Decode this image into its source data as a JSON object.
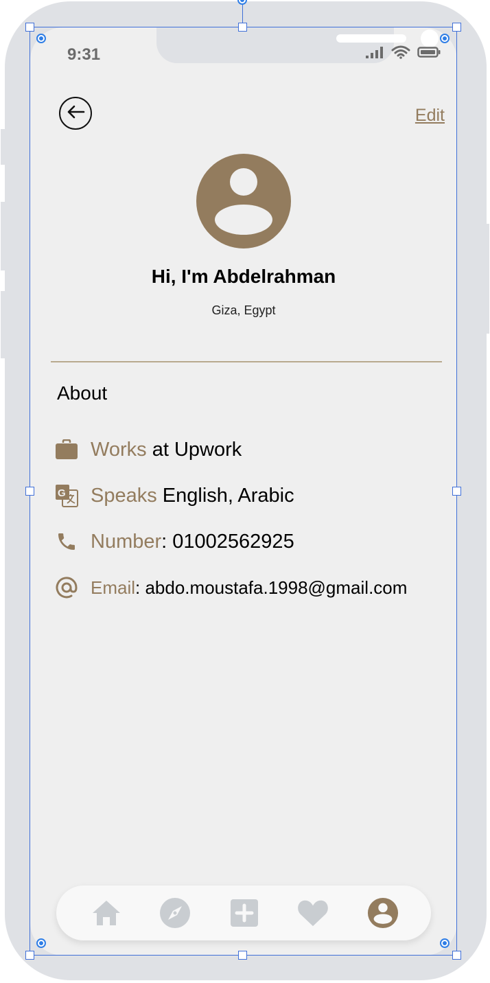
{
  "status_bar": {
    "time": "9:31",
    "icons": [
      "signal-icon",
      "wifi-icon",
      "battery-icon"
    ]
  },
  "header": {
    "back_icon": "arrow-left-icon",
    "edit_label": "Edit"
  },
  "profile": {
    "avatar_icon": "user-avatar-icon",
    "greeting": "Hi, I'm Abdelrahman",
    "location": "Giza, Egypt"
  },
  "about": {
    "title": "About",
    "items": [
      {
        "icon": "briefcase-icon",
        "label": "Works",
        "sep": " ",
        "value": "at Upwork"
      },
      {
        "icon": "translate-icon",
        "label": "Speaks",
        "sep": " ",
        "value": "English, Arabic"
      },
      {
        "icon": "phone-icon",
        "label": "Number",
        "sep": ": ",
        "value": "01002562925"
      },
      {
        "icon": "at-sign-icon",
        "label": "Email",
        "sep": ": ",
        "value": "abdo.moustafa.1998@gmail.com"
      }
    ]
  },
  "bottom_nav": {
    "items": [
      {
        "icon": "home-icon",
        "active": false
      },
      {
        "icon": "compass-icon",
        "active": false
      },
      {
        "icon": "add-square-icon",
        "active": false
      },
      {
        "icon": "heart-icon",
        "active": false
      },
      {
        "icon": "profile-icon",
        "active": true
      }
    ]
  },
  "colors": {
    "accent": "#937c5e",
    "screen_bg": "#efefef",
    "frame": "#dfe1e5",
    "nav_inactive": "#c9cdd1",
    "selection": "#3f6fd8"
  }
}
